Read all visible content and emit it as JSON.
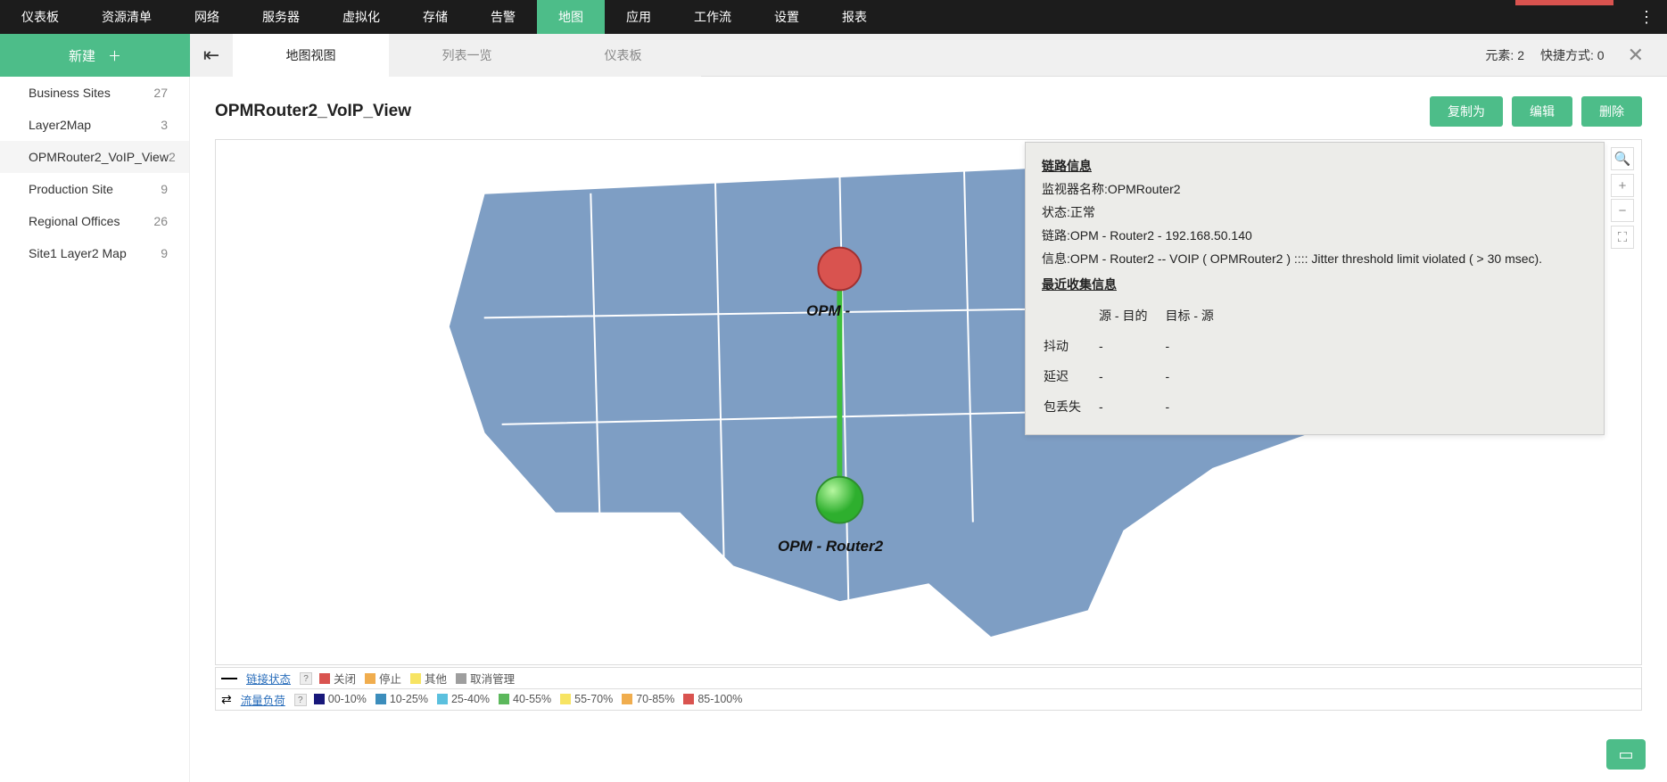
{
  "nav": {
    "items": [
      "仪表板",
      "资源清单",
      "网络",
      "服务器",
      "虚拟化",
      "存储",
      "告警",
      "地图",
      "应用",
      "工作流",
      "设置",
      "报表"
    ],
    "active": "地图"
  },
  "second_bar": {
    "new_label": "新建",
    "tabs": [
      "地图视图",
      "列表一览",
      "仪表板"
    ],
    "active_tab": "地图视图",
    "elements_label": "元素:",
    "elements_count": "2",
    "shortcut_label": "快捷方式:",
    "shortcut_count": "0"
  },
  "sidebar": {
    "items": [
      {
        "label": "Business Sites",
        "count": "27"
      },
      {
        "label": "Layer2Map",
        "count": "3"
      },
      {
        "label": "OPMRouter2_VoIP_View",
        "count": "2"
      },
      {
        "label": "Production Site",
        "count": "9"
      },
      {
        "label": "Regional Offices",
        "count": "26"
      },
      {
        "label": "Site1 Layer2 Map",
        "count": "9"
      }
    ],
    "active": "OPMRouter2_VoIP_View"
  },
  "page": {
    "title": "OPMRouter2_VoIP_View",
    "actions": {
      "copy": "复制为",
      "edit": "编辑",
      "delete": "删除"
    }
  },
  "map": {
    "node1_label": "OPM -",
    "node2_label": "OPM - Router2"
  },
  "popup": {
    "header1": "链路信息",
    "monitor_label": "监视器名称:",
    "monitor_value": "OPMRouter2",
    "status_label": "状态:",
    "status_value": "正常",
    "link_label": "链路:",
    "link_value": "OPM - Router2 - 192.168.50.140",
    "info_label": "信息:",
    "info_value": "OPM - Router2 -- VOIP ( OPMRouter2 ) :::: Jitter threshold limit violated ( > 30 msec).",
    "header2": "最近收集信息",
    "col1": "源 - 目的",
    "col2": "目标 - 源",
    "rows": [
      {
        "label": "抖动",
        "v1": "-",
        "v2": "-"
      },
      {
        "label": "延迟",
        "v1": "-",
        "v2": "-"
      },
      {
        "label": "包丢失",
        "v1": "-",
        "v2": "-"
      }
    ]
  },
  "legend": {
    "link_status": {
      "title": "链接状态",
      "items": [
        {
          "color": "#d9534f",
          "label": "关闭"
        },
        {
          "color": "#f0ad4e",
          "label": "停止"
        },
        {
          "color": "#f7e463",
          "label": "其他"
        },
        {
          "color": "#9e9e9e",
          "label": "取消管理"
        }
      ]
    },
    "traffic": {
      "title": "流量负荷",
      "items": [
        {
          "color": "#17177a",
          "label": "00-10%"
        },
        {
          "color": "#3c8dbc",
          "label": "10-25%"
        },
        {
          "color": "#5bc0de",
          "label": "25-40%"
        },
        {
          "color": "#5cb85c",
          "label": "40-55%"
        },
        {
          "color": "#f7e463",
          "label": "55-70%"
        },
        {
          "color": "#f0ad4e",
          "label": "70-85%"
        },
        {
          "color": "#d9534f",
          "label": "85-100%"
        }
      ]
    }
  }
}
